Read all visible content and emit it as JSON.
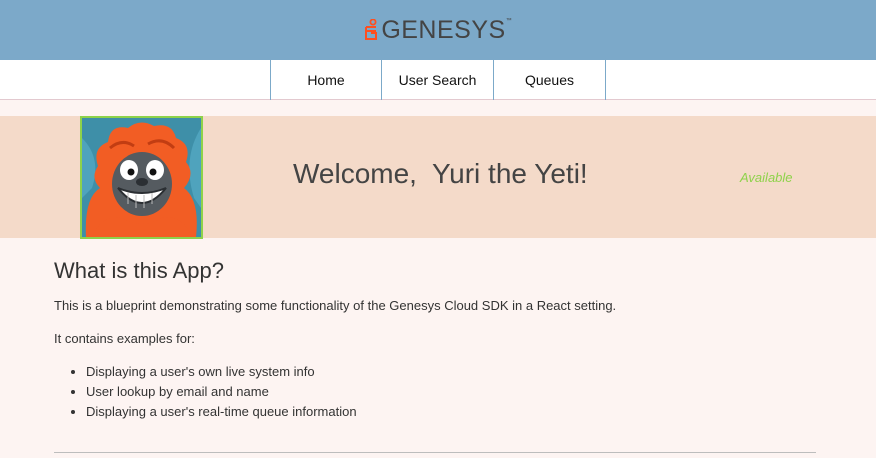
{
  "header": {
    "logo_text": "GENESYS",
    "logo_tm": "™"
  },
  "nav": {
    "items": [
      {
        "label": "Home"
      },
      {
        "label": "User Search"
      },
      {
        "label": "Queues"
      }
    ]
  },
  "profile": {
    "greeting": "Welcome,  Yuri the Yeti!",
    "status": "Available",
    "status_color": "#8ed24a"
  },
  "about": {
    "heading": "What is this App?",
    "intro": "This is a blueprint demonstrating some functionality of the Genesys Cloud SDK in a React setting.",
    "contains": "It contains examples for:",
    "features": [
      "Displaying a user's own live system info",
      "User lookup by email and name",
      "Displaying a user's real-time queue information"
    ]
  },
  "colors": {
    "header_bg": "#7ca9c9",
    "welcome_bg": "#f4dac9",
    "page_bg": "#fdf4f2",
    "accent": "#ff4f1f"
  }
}
